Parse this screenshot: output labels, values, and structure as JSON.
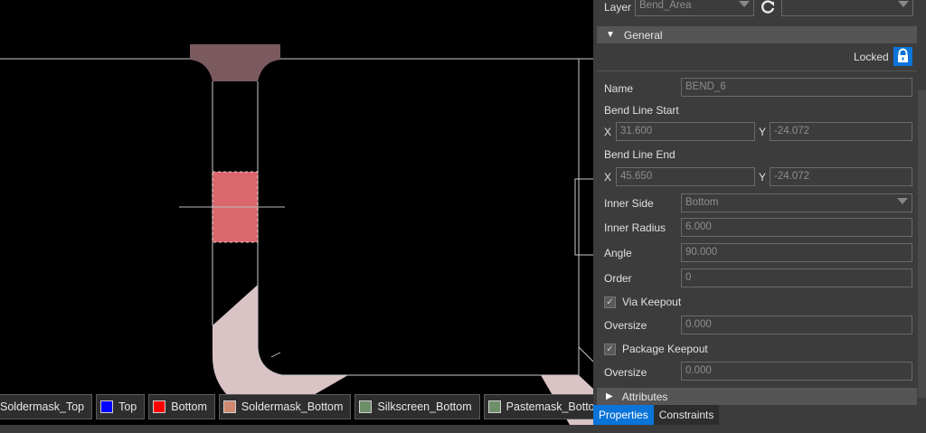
{
  "canvas": {
    "colors": {
      "outline": "#cccccc",
      "solder_mask": "#7a5a5f",
      "bend_area": "#d9676d",
      "keepout": "#d9c3c5"
    }
  },
  "layers": [
    {
      "label": "Soldermask_Top",
      "color": ""
    },
    {
      "label": "Top",
      "color": "#0000ff"
    },
    {
      "label": "Bottom",
      "color": "#ff0000"
    },
    {
      "label": "Soldermask_Bottom",
      "color": "#d08870"
    },
    {
      "label": "Silkscreen_Bottom",
      "color": "#6d8f6a"
    },
    {
      "label": "Pastemask_Bottom",
      "color": "#6d8f6a"
    }
  ],
  "panel": {
    "layer_label": "Layer",
    "layer_value": "Bend_Area",
    "general_header": "General",
    "locked_label": "Locked",
    "name_label": "Name",
    "name_value": "BEND_6",
    "bend_line_start_label": "Bend Line Start",
    "start_x_label": "X",
    "start_x": "31.600",
    "start_y_label": "Y",
    "start_y": "-24.072",
    "bend_line_end_label": "Bend Line End",
    "end_x_label": "X",
    "end_x": "45.650",
    "end_y_label": "Y",
    "end_y": "-24.072",
    "inner_side_label": "Inner Side",
    "inner_side_value": "Bottom",
    "inner_radius_label": "Inner Radius",
    "inner_radius_value": "6.000",
    "angle_label": "Angle",
    "angle_value": "90.000",
    "order_label": "Order",
    "order_value": "0",
    "via_keepout_label": "Via Keepout",
    "via_keepout_checked": true,
    "oversize_label": "Oversize",
    "via_oversize_value": "0.000",
    "package_keepout_label": "Package Keepout",
    "package_keepout_checked": true,
    "package_oversize_label": "Oversize",
    "package_oversize_value": "0.000",
    "attributes_header": "Attributes"
  },
  "tabs": [
    {
      "label": "Properties",
      "active": true
    },
    {
      "label": "Constraints",
      "active": false
    }
  ]
}
